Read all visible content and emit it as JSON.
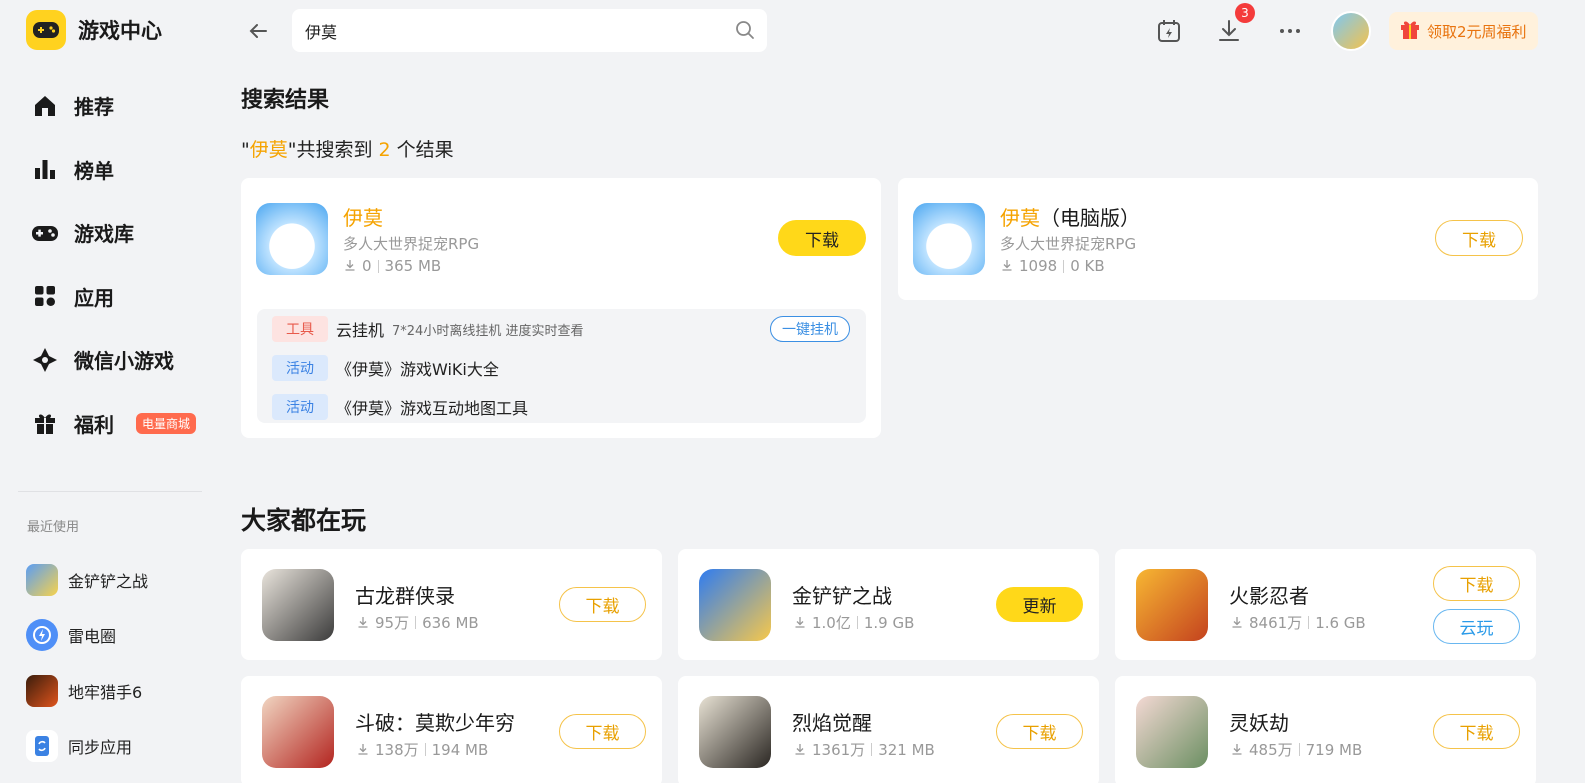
{
  "app": {
    "title": "游戏中心",
    "brand_color": "#ffd21f"
  },
  "sidebar": {
    "items": [
      {
        "label": "推荐",
        "icon": "home-icon"
      },
      {
        "label": "榜单",
        "icon": "chart-icon"
      },
      {
        "label": "游戏库",
        "icon": "gamepad-icon"
      },
      {
        "label": "应用",
        "icon": "apps-icon"
      },
      {
        "label": "微信小游戏",
        "icon": "wechat-game-icon"
      },
      {
        "label": "福利",
        "icon": "gift-icon",
        "badge": "电量商城"
      }
    ],
    "recent_title": "最近使用",
    "recent": [
      {
        "label": "金铲铲之战"
      },
      {
        "label": "雷电圈"
      },
      {
        "label": "地牢猎手6"
      },
      {
        "label": "同步应用"
      }
    ]
  },
  "topbar": {
    "search_value": "伊莫",
    "download_badge": "3",
    "welfare_label": "领取2元周福利"
  },
  "results": {
    "heading": "搜索结果",
    "summary_quote_open": "\"",
    "summary_keyword": "伊莫",
    "summary_mid": "\"共搜索到 ",
    "summary_count": "2",
    "summary_end": " 个结果",
    "cards": [
      {
        "name": "伊莫",
        "subtitle": "多人大世界捉宠RPG",
        "downloads": "0",
        "size": "365 MB",
        "button": "下载",
        "extras": [
          {
            "tag": "工具",
            "title": "云挂机",
            "desc": "7*24小时离线挂机 进度实时查看",
            "action": "一键挂机"
          },
          {
            "tag": "活动",
            "title": "《伊莫》游戏WiKi大全"
          },
          {
            "tag": "活动",
            "title": "《伊莫》游戏互动地图工具"
          }
        ]
      },
      {
        "name": "伊莫",
        "name_suffix": "（电脑版）",
        "subtitle": "多人大世界捉宠RPG",
        "downloads": "1098",
        "size": "0 KB",
        "button": "下载"
      }
    ]
  },
  "popular": {
    "heading": "大家都在玩",
    "games": [
      {
        "name": "古龙群侠录",
        "downloads": "95万",
        "size": "636 MB",
        "button": "下载"
      },
      {
        "name": "金铲铲之战",
        "downloads": "1.0亿",
        "size": "1.9 GB",
        "button": "更新"
      },
      {
        "name": "火影忍者",
        "downloads": "8461万",
        "size": "1.6 GB",
        "button": "下载",
        "button2": "云玩"
      },
      {
        "name": "斗破：莫欺少年穷",
        "downloads": "138万",
        "size": "194 MB",
        "button": "下载"
      },
      {
        "name": "烈焰觉醒",
        "downloads": "1361万",
        "size": "321 MB",
        "button": "下载"
      },
      {
        "name": "灵妖劫",
        "downloads": "485万",
        "size": "719 MB",
        "button": "下载"
      }
    ]
  }
}
